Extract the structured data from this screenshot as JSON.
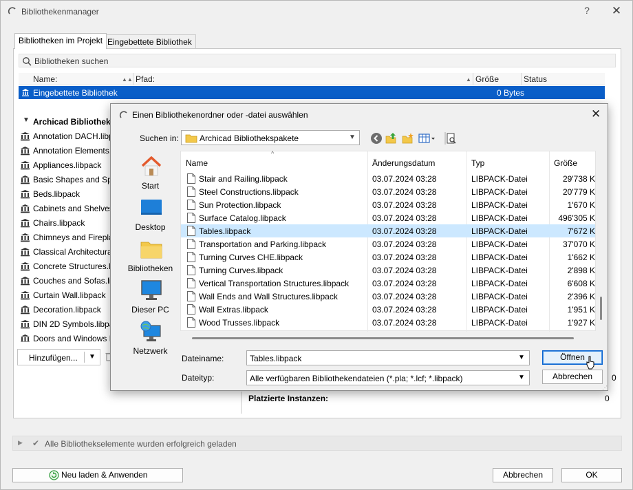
{
  "window": {
    "title": "Bibliothekenmanager",
    "help": "?",
    "close": "✕"
  },
  "tabs": [
    {
      "label": "Bibliotheken im Projekt"
    },
    {
      "label": "Eingebettete Bibliothek"
    }
  ],
  "search": {
    "placeholder": "Bibliotheken suchen"
  },
  "table": {
    "headers": {
      "name": "Name:",
      "path": "Pfad:",
      "size": "Größe",
      "status": "Status"
    },
    "embedded_row": {
      "label": "Eingebettete Bibliothek",
      "size": "0 Bytes"
    }
  },
  "tree": {
    "group_label": "Archicad Bibliothekspakete",
    "items": [
      "Annotation DACH.libpack",
      "Annotation Elements.libpack",
      "Appliances.libpack",
      "Basic Shapes and Special.libpack",
      "Beds.libpack",
      "Cabinets and Shelves.libpack",
      "Chairs.libpack",
      "Chimneys and Fireplaces.libpack",
      "Classical Architectural Elements.libpack",
      "Concrete Structures.libpack",
      "Couches and Sofas.libpack",
      "Curtain Wall.libpack",
      "Decoration.libpack",
      "DIN 2D Symbols.libpack",
      "Doors and Windows DACH.libpack"
    ]
  },
  "add_button": {
    "label": "Hinzufügen..."
  },
  "right_panel": {
    "value1": "0",
    "value2": "0",
    "placed_label": "Platzierte Instanzen:"
  },
  "status": {
    "text": "Alle Bibliothekselemente wurden erfolgreich geladen"
  },
  "buttons": {
    "reload": "Neu laden & Anwenden",
    "cancel": "Abbrechen",
    "ok": "OK"
  },
  "file_dialog": {
    "title": "Einen Bibliothekenordner oder -datei auswählen",
    "close": "✕",
    "look_in_label": "Suchen in:",
    "look_in_value": "Archicad Bibliothekspakete",
    "places": [
      "Start",
      "Desktop",
      "Bibliotheken",
      "Dieser PC",
      "Netzwerk"
    ],
    "columns": {
      "name": "Name",
      "date": "Änderungsdatum",
      "type": "Typ",
      "size": "Größe"
    },
    "files": [
      {
        "name": "Stair and Railing.libpack",
        "date": "03.07.2024 03:28",
        "type": "LIBPACK-Datei",
        "size": "29'738 K"
      },
      {
        "name": "Steel Constructions.libpack",
        "date": "03.07.2024 03:28",
        "type": "LIBPACK-Datei",
        "size": "20'779 K"
      },
      {
        "name": "Sun Protection.libpack",
        "date": "03.07.2024 03:28",
        "type": "LIBPACK-Datei",
        "size": "1'670 K"
      },
      {
        "name": "Surface Catalog.libpack",
        "date": "03.07.2024 03:28",
        "type": "LIBPACK-Datei",
        "size": "496'305 K"
      },
      {
        "name": "Tables.libpack",
        "date": "03.07.2024 03:28",
        "type": "LIBPACK-Datei",
        "size": "7'672 K",
        "selected": true
      },
      {
        "name": "Transportation and Parking.libpack",
        "date": "03.07.2024 03:28",
        "type": "LIBPACK-Datei",
        "size": "37'070 K"
      },
      {
        "name": "Turning Curves CHE.libpack",
        "date": "03.07.2024 03:28",
        "type": "LIBPACK-Datei",
        "size": "1'662 K"
      },
      {
        "name": "Turning Curves.libpack",
        "date": "03.07.2024 03:28",
        "type": "LIBPACK-Datei",
        "size": "2'898 K"
      },
      {
        "name": "Vertical Transportation Structures.libpack",
        "date": "03.07.2024 03:28",
        "type": "LIBPACK-Datei",
        "size": "6'608 K"
      },
      {
        "name": "Wall Ends and Wall Structures.libpack",
        "date": "03.07.2024 03:28",
        "type": "LIBPACK-Datei",
        "size": "2'396 K"
      },
      {
        "name": "Wall Extras.libpack",
        "date": "03.07.2024 03:28",
        "type": "LIBPACK-Datei",
        "size": "1'951 K"
      },
      {
        "name": "Wood Trusses.libpack",
        "date": "03.07.2024 03:28",
        "type": "LIBPACK-Datei",
        "size": "1'927 K"
      }
    ],
    "filename_label": "Dateiname:",
    "filename_value": "Tables.libpack",
    "filetype_label": "Dateityp:",
    "filetype_value": "Alle verfügbaren Bibliothekendateien (*.pla; *.lcf; *.libpack)",
    "open_button": "Öffnen",
    "cancel_button": "Abbrechen"
  },
  "colors": {
    "selection": "#0a5ec8",
    "file_selection": "#cce8ff",
    "accent": "#0a64d0"
  }
}
